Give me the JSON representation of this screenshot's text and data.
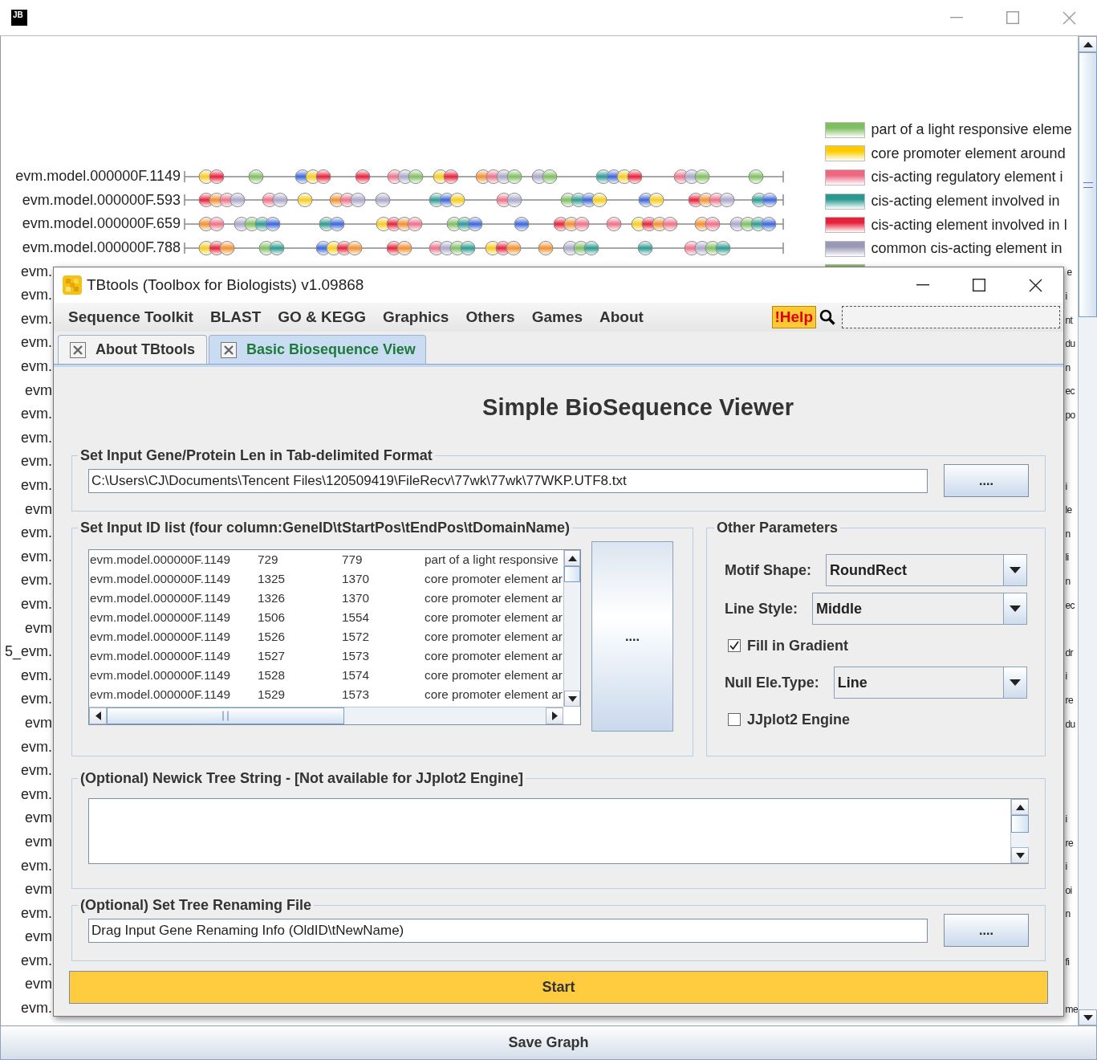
{
  "outer_window": {
    "logo": "JB"
  },
  "gene_rows": [
    {
      "kind": "full",
      "label": "evm.model.000000F.1149"
    },
    {
      "kind": "full",
      "label": "evm.model.000000F.593"
    },
    {
      "kind": "full",
      "label": "evm.model.000000F.659"
    },
    {
      "kind": "full",
      "label": "evm.model.000000F.788"
    },
    {
      "kind": "tail",
      "label": "evm."
    },
    {
      "kind": "tail",
      "label": "evm."
    },
    {
      "kind": "tail",
      "label": "evm."
    },
    {
      "kind": "tail",
      "label": "evm."
    },
    {
      "kind": "tail",
      "label": "evm."
    },
    {
      "kind": "tail",
      "label": "evm"
    },
    {
      "kind": "tail",
      "label": "evm."
    },
    {
      "kind": "tail",
      "label": "evm."
    },
    {
      "kind": "tail",
      "label": "evm."
    },
    {
      "kind": "tail",
      "label": "evm."
    },
    {
      "kind": "tail",
      "label": "evm"
    },
    {
      "kind": "tail",
      "label": "evm."
    },
    {
      "kind": "tail",
      "label": "evm."
    },
    {
      "kind": "tail",
      "label": "evm."
    },
    {
      "kind": "tail",
      "label": "evm."
    },
    {
      "kind": "tail",
      "label": "evm"
    },
    {
      "kind": "tail",
      "label": "5_evm."
    },
    {
      "kind": "tail",
      "label": "evm."
    },
    {
      "kind": "tail",
      "label": "evm."
    },
    {
      "kind": "tail",
      "label": "evm"
    },
    {
      "kind": "tail",
      "label": "evm."
    },
    {
      "kind": "tail",
      "label": "evm."
    },
    {
      "kind": "tail",
      "label": "evm."
    },
    {
      "kind": "tail",
      "label": "evm"
    },
    {
      "kind": "tail",
      "label": "evm"
    },
    {
      "kind": "tail",
      "label": "evm."
    },
    {
      "kind": "tail",
      "label": "evm"
    },
    {
      "kind": "tail",
      "label": "evm."
    },
    {
      "kind": "tail",
      "label": "evm"
    },
    {
      "kind": "tail",
      "label": "evm."
    },
    {
      "kind": "tail",
      "label": "evm"
    },
    {
      "kind": "tail",
      "label": "evm."
    }
  ],
  "legend": [
    {
      "kind": "entry",
      "color": "#7fbf5f",
      "text": "part of a light responsive eleme"
    },
    {
      "kind": "entry",
      "color": "#ffcc00",
      "text": "core promoter element around"
    },
    {
      "kind": "entry",
      "color": "#ee6680",
      "text": "cis-acting regulatory element i"
    },
    {
      "kind": "entry",
      "color": "#2a9a90",
      "text": "cis-acting element involved in"
    },
    {
      "kind": "entry",
      "color": "#e8203a",
      "text": "cis-acting element involved in l"
    },
    {
      "kind": "entry",
      "color": "#9a98b8",
      "text": "common cis-acting element in"
    },
    {
      "kind": "tail",
      "color": "#88bb66",
      "text": "e"
    },
    {
      "kind": "tail",
      "text": "i"
    },
    {
      "kind": "tail",
      "text": "nt"
    },
    {
      "kind": "tail",
      "text": "du"
    },
    {
      "kind": "tail",
      "text": "n"
    },
    {
      "kind": "tail",
      "text": "ec"
    },
    {
      "kind": "tail",
      "text": "po"
    },
    {
      "kind": "blank"
    },
    {
      "kind": "blank"
    },
    {
      "kind": "tail",
      "text": "i"
    },
    {
      "kind": "tail",
      "text": "le"
    },
    {
      "kind": "tail",
      "text": "n"
    },
    {
      "kind": "tail",
      "text": "li"
    },
    {
      "kind": "tail",
      "text": "n"
    },
    {
      "kind": "tail",
      "text": "ec"
    },
    {
      "kind": "blank"
    },
    {
      "kind": "tail",
      "text": "dr"
    },
    {
      "kind": "tail",
      "text": "i"
    },
    {
      "kind": "tail",
      "text": "re"
    },
    {
      "kind": "tail",
      "text": "du"
    },
    {
      "kind": "blank"
    },
    {
      "kind": "blank"
    },
    {
      "kind": "blank"
    },
    {
      "kind": "tail",
      "text": "i"
    },
    {
      "kind": "tail",
      "text": "re"
    },
    {
      "kind": "tail",
      "text": "i"
    },
    {
      "kind": "tail",
      "text": "oi"
    },
    {
      "kind": "tail",
      "text": "n"
    },
    {
      "kind": "blank"
    },
    {
      "kind": "tail",
      "text": "fi"
    },
    {
      "kind": "blank"
    },
    {
      "kind": "tail",
      "text": "me"
    }
  ],
  "save_button": "Save Graph",
  "dialog": {
    "title": "TBtools (Toolbox for Biologists) v1.09868",
    "menu": [
      "Sequence Toolkit",
      "BLAST",
      "GO & KEGG",
      "Graphics",
      "Others",
      "Games",
      "About"
    ],
    "help": "!Help",
    "tabs": [
      {
        "label": "About TBtools",
        "selected": false
      },
      {
        "label": "Basic Biosequence View",
        "selected": true
      }
    ],
    "heading": "Simple BioSequence Viewer",
    "len_section": {
      "legend": "Set Input Gene/Protein Len in Tab-delimited Format",
      "value": "C:\\Users\\CJ\\Documents\\Tencent Files\\120509419\\FileRecv\\77wk\\77wk\\77WKP.UTF8.txt",
      "button": "...."
    },
    "id_section": {
      "legend": "Set Input ID list (four column:GeneID\\tStartPos\\tEndPos\\tDomainName)",
      "button": "....",
      "rows": [
        [
          "evm.model.000000F.1149",
          "729",
          "779",
          "part of a light responsive"
        ],
        [
          "evm.model.000000F.1149",
          "1325",
          "1370",
          "core promoter element ar"
        ],
        [
          "evm.model.000000F.1149",
          "1326",
          "1370",
          "core promoter element ar"
        ],
        [
          "evm.model.000000F.1149",
          "1506",
          "1554",
          "core promoter element ar"
        ],
        [
          "evm.model.000000F.1149",
          "1526",
          "1572",
          "core promoter element ar"
        ],
        [
          "evm.model.000000F.1149",
          "1527",
          "1573",
          "core promoter element ar"
        ],
        [
          "evm.model.000000F.1149",
          "1528",
          "1574",
          "core promoter element ar"
        ],
        [
          "evm.model.000000F.1149",
          "1529",
          "1573",
          "core promoter element ar"
        ]
      ]
    },
    "params": {
      "legend": "Other Parameters",
      "fields": [
        {
          "kind": "dropdown",
          "label": "Motif Shape:",
          "value": "RoundRect"
        },
        {
          "kind": "dropdown",
          "label": "Line Style:",
          "value": "Middle"
        },
        {
          "kind": "checkbox",
          "label": "Fill in Gradient",
          "checked": true
        },
        {
          "kind": "dropdown",
          "label": "Null Ele.Type:",
          "value": "Line"
        },
        {
          "kind": "checkbox",
          "label": "JJplot2 Engine",
          "checked": false
        }
      ]
    },
    "newick": {
      "legend": "(Optional) Newick Tree String - [Not available for JJplot2 Engine]"
    },
    "rename": {
      "legend": "(Optional) Set Tree Renaming File",
      "placeholder": "Drag Input Gene Renaming Info (OldID\\tNewName)",
      "button": "...."
    },
    "start": "Start"
  }
}
